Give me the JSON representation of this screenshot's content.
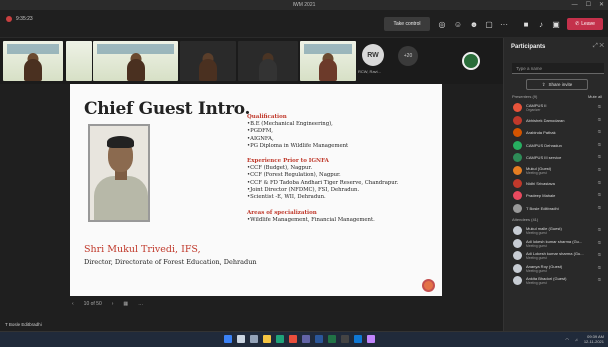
{
  "window": {
    "title": "IWM 2021",
    "controls": [
      "—",
      "☐",
      "✕"
    ]
  },
  "toolbar": {
    "timer": "9:35:23",
    "take_control": "Take control",
    "icons": [
      "people-icon",
      "chat-icon",
      "reactions-icon",
      "rooms-icon",
      "more-icon",
      "camera-icon",
      "mic-icon",
      "share-icon"
    ],
    "leave": "Leave"
  },
  "strip": {
    "rw_initials": "RW",
    "rw_label": "RCW, Ravi...",
    "overflow": "+20"
  },
  "slide": {
    "title": "Chief Guest Intro.",
    "name": "Shri Mukul Trivedi, IFS,",
    "role": "Director, Directorate of Forest Education, Dehradun",
    "sections": [
      {
        "heading": "Qualification",
        "items": [
          "•B.E (Mechanical Engineering),",
          "•PGDFM,",
          "•AIGNFA,",
          "•PG Diploma in Wildlife Management"
        ]
      },
      {
        "heading": "Experience Prior to IGNFA",
        "items": [
          "•CCF (Budget), Nagpur.",
          "•CCF (Forest Regulation), Nagpur.",
          "•CCF & FD Tadoba Andhari Tiger Reserve, Chandrapur.",
          "•Joint Director (NFDMC), FSI, Dehradun.",
          "•Scientist -E, WII, Dehradun."
        ]
      },
      {
        "heading": "Areas of specialization",
        "items": [
          "•Wildlife Management, Financial Management."
        ]
      }
    ]
  },
  "slide_controls": {
    "prev": "‹",
    "page": "10 of 50",
    "next": "›",
    "more": "…"
  },
  "presenter": "T Bosle Editbradhi",
  "participants": {
    "title": "Participants",
    "search_placeholder": "Type a name",
    "share_invite": "Share invite",
    "presenters_label": "Presenters (9)",
    "mute_all": "Mute all",
    "presenters": [
      {
        "name": "CAMPUS II",
        "status": "Organizer",
        "color": "#e8543b"
      },
      {
        "name": "Abhishek Damodaran",
        "status": "",
        "color": "#c0392b"
      },
      {
        "name": "Arabinda Pathak",
        "status": "",
        "color": "#d35400"
      },
      {
        "name": "CAMPUS Dehradun",
        "status": "",
        "color": "#27ae60"
      },
      {
        "name": "CAMPUS III service",
        "status": "",
        "color": "#2e8b57"
      },
      {
        "name": "Mukul (Guest)",
        "status": "Meeting guest",
        "color": "#e67e22"
      },
      {
        "name": "Nidhi Srivastava",
        "status": "",
        "color": "#c0392b"
      },
      {
        "name": "Pradeep Mahale",
        "status": "",
        "color": "#e84a5f"
      },
      {
        "name": "T Bosle Editbradhi",
        "status": "",
        "color": "#999999"
      }
    ],
    "attendees_label": "Attendees (41)",
    "attendees": [
      {
        "name": "Mukul malle (Guest)",
        "status": "Meeting guest",
        "color": "#c7ccd3"
      },
      {
        "name": "Adi lokesh kumar sharma (Gu...",
        "status": "Meeting guest",
        "color": "#c7ccd3"
      },
      {
        "name": "Adi Lokesh kumar sharma (Gu...",
        "status": "Meeting guest",
        "color": "#c7ccd3"
      },
      {
        "name": "Ananya Roy (Guest)",
        "status": "Meeting guest",
        "color": "#c7ccd3"
      },
      {
        "name": "Ankita Bhadori (Guest)",
        "status": "Meeting guest",
        "color": "#c7ccd3"
      }
    ]
  },
  "taskbar": {
    "icons": [
      "windows-icon",
      "search-icon",
      "taskview-icon",
      "explorer-icon",
      "edge-icon",
      "chrome-icon",
      "teams-icon",
      "word-icon",
      "excel-icon",
      "store-icon",
      "mail-icon",
      "photos-icon"
    ],
    "time": "09:39 AM",
    "date": "12-11-2021"
  }
}
